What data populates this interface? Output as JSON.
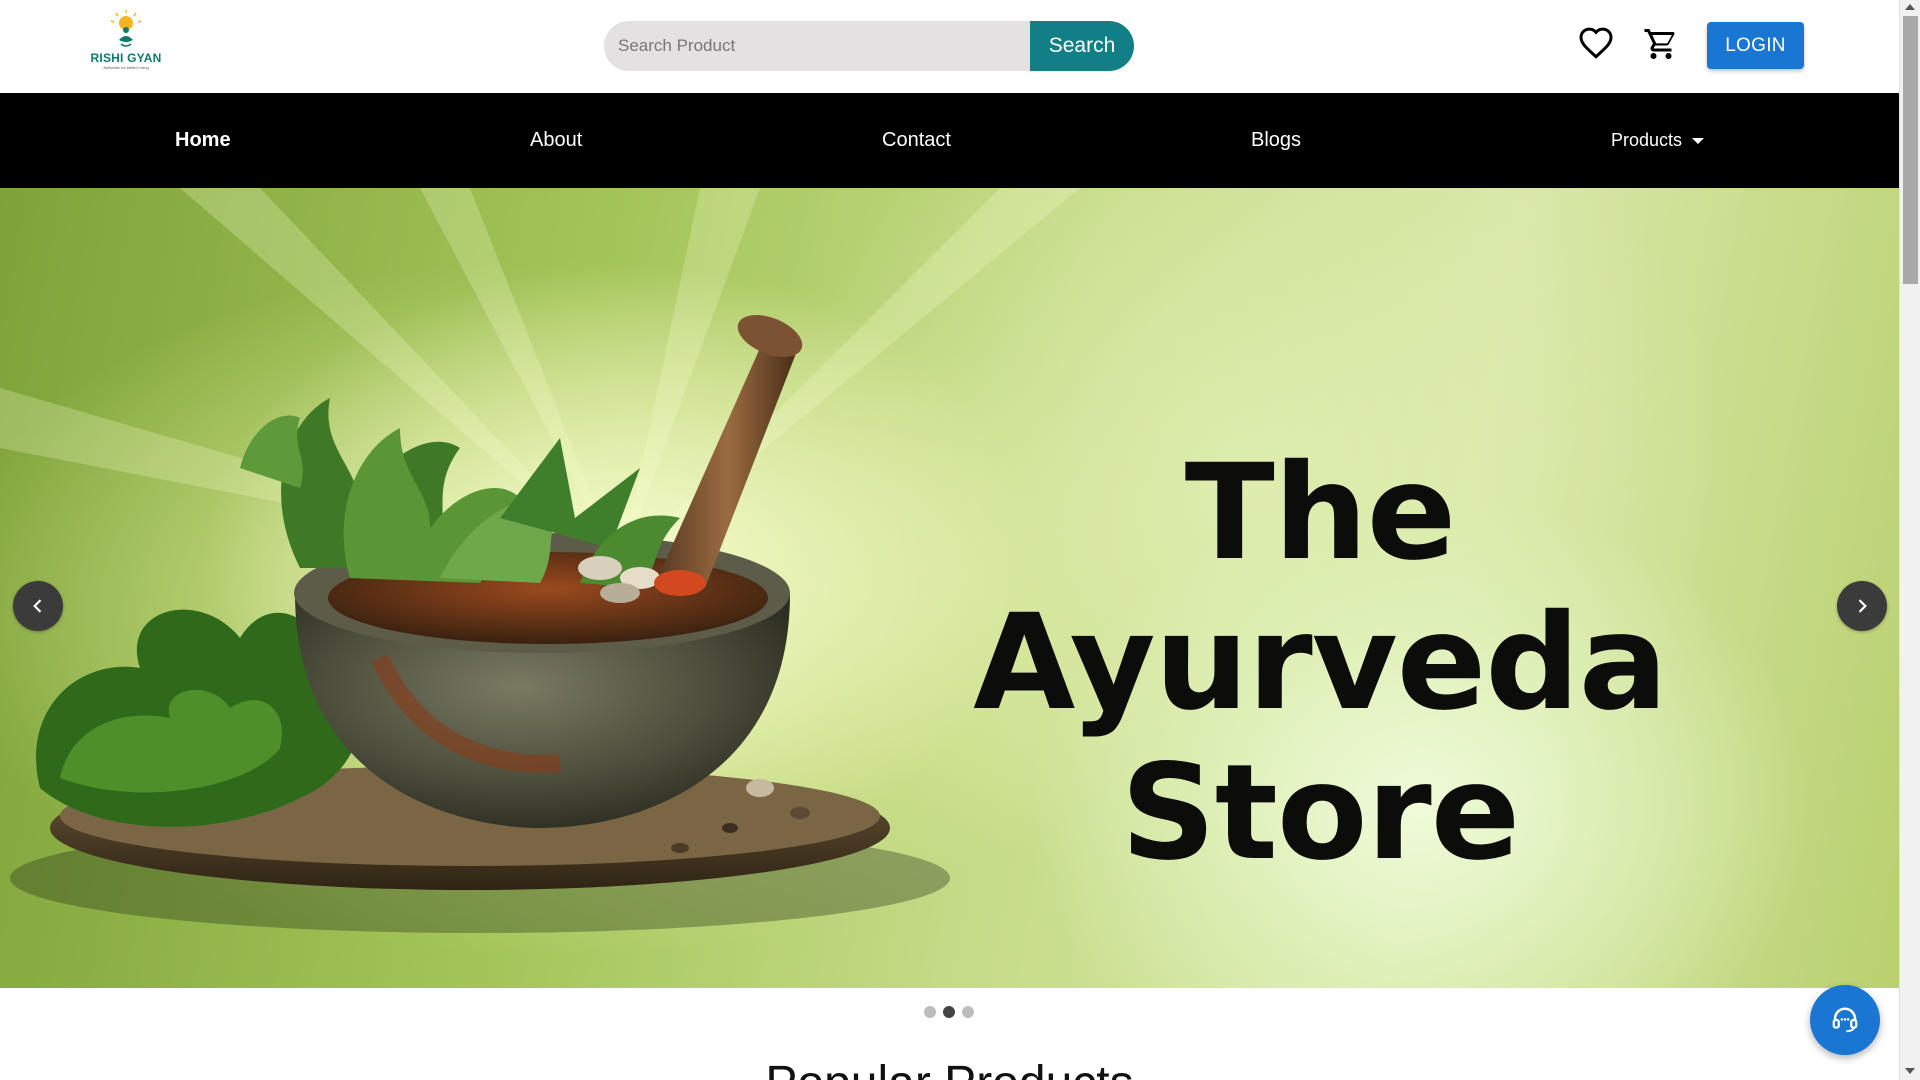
{
  "header": {
    "logo": {
      "name": "RISHI GYAN",
      "tagline": "Authentic for better Living"
    },
    "search": {
      "placeholder": "Search Product",
      "button_label": "Search"
    },
    "wishlist_icon": "heart-outline",
    "cart_icon": "shopping-cart",
    "login_label": "LOGIN"
  },
  "nav": {
    "items": [
      {
        "label": "Home",
        "active": true
      },
      {
        "label": "About"
      },
      {
        "label": "Contact"
      },
      {
        "label": "Blogs"
      },
      {
        "label": "Products",
        "has_dropdown": true
      }
    ]
  },
  "hero": {
    "title": "The Ayurveda\nStore",
    "slide_count": 3,
    "active_slide": 2,
    "prev_icon": "chevron-left",
    "next_icon": "chevron-right"
  },
  "section": {
    "title": "Popular Products"
  },
  "support": {
    "icon": "headset"
  },
  "colors": {
    "primary_blue": "#1976d2",
    "search_teal": "#127f86",
    "nav_bg": "#000000",
    "logo_green": "#0d7a6e"
  }
}
